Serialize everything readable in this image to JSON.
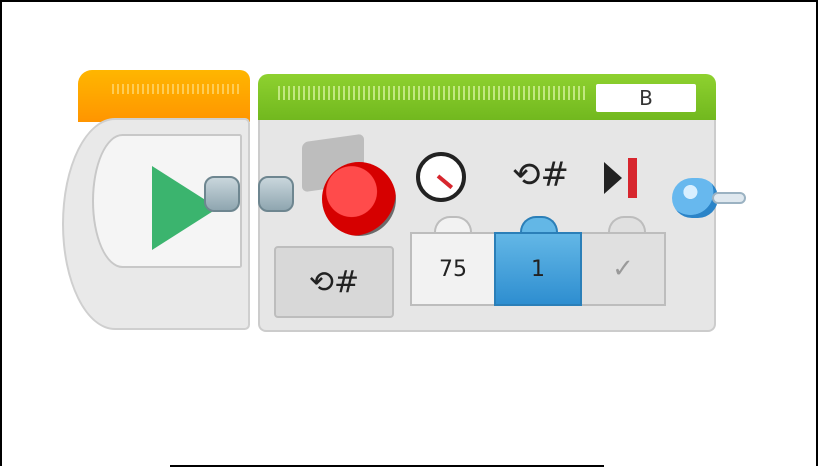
{
  "start_block": {
    "play_icon": "play-triangle"
  },
  "motor_block": {
    "port": "B",
    "mode_icon": "⟲#",
    "params": {
      "speed": "75",
      "rotations": "1",
      "brake": "✓"
    },
    "icons": {
      "speed": "speedometer-icon",
      "rotations": "⟲#",
      "brake": "brake-icon"
    }
  },
  "colors": {
    "start_header": "#ff9500",
    "motor_header": "#7cc225",
    "motor_hub": "#d60000",
    "selected_param": "#3b9ad9",
    "play": "#3bb46e"
  }
}
